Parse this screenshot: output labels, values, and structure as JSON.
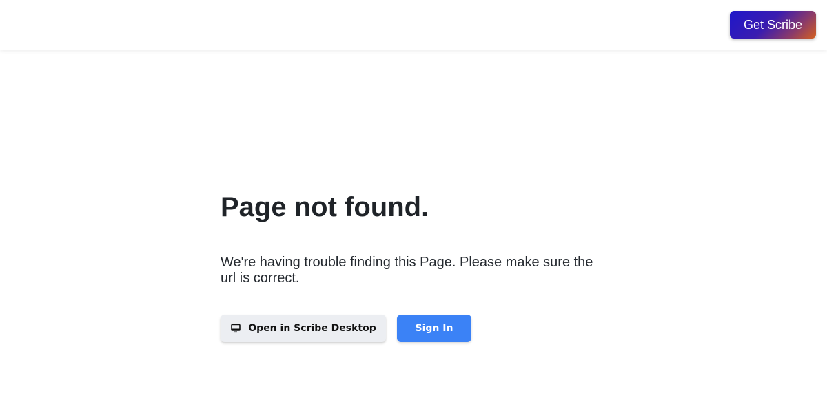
{
  "header": {
    "cta_label": "Get Scribe",
    "cta_gradient": [
      "#1f17c9",
      "#d4601f"
    ]
  },
  "main": {
    "title": "Page not found.",
    "message": "We're having trouble finding this Page. Please make sure the url is correct.",
    "open_desktop": {
      "label": "Open in Scribe Desktop",
      "icon": "desktop-icon"
    },
    "sign_in": {
      "label": "Sign In",
      "color": "#3b82f6"
    }
  }
}
